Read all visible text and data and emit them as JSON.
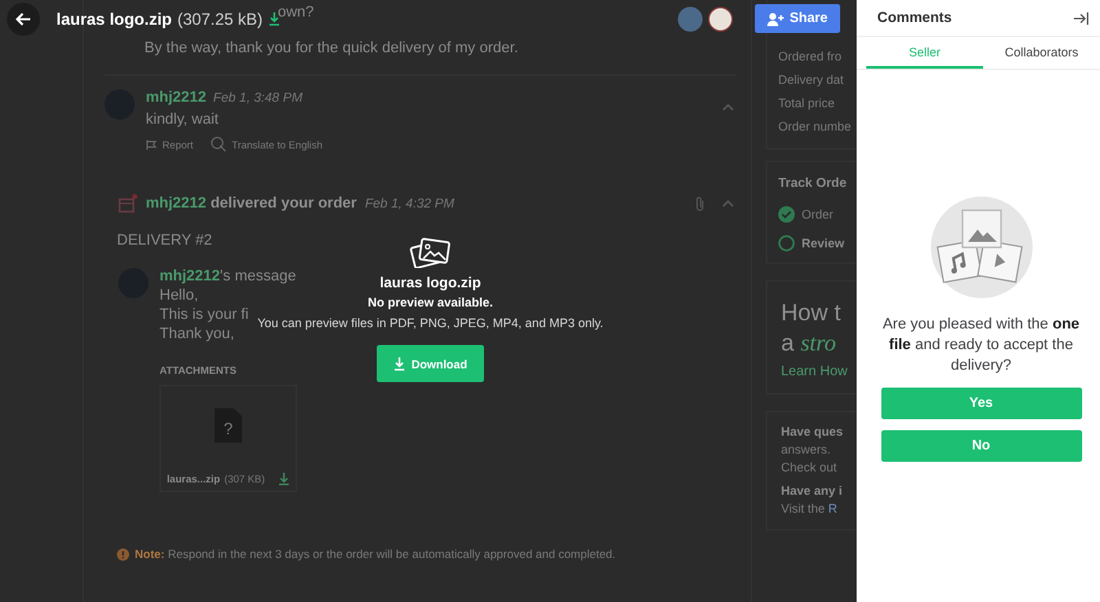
{
  "preview_header": {
    "file_name": "lauras logo.zip",
    "file_size": "(307.25 kB)",
    "share_button": "Share"
  },
  "conversation": {
    "cut_line": "own?",
    "message_tail": "By the way, thank you for the quick delivery of my order.",
    "reply": {
      "author": "mhj2212",
      "time": "Feb 1, 3:48 PM",
      "text": "kindly, wait",
      "actions": [
        "Report",
        "Translate to English"
      ]
    },
    "delivery_event": {
      "author": "mhj2212",
      "action": "delivered your order",
      "time": "Feb 1, 4:32 PM"
    },
    "delivery": {
      "heading": "DELIVERY #2",
      "author": "mhj2212",
      "author_suffix": "'s message",
      "lines": [
        "Hello,",
        "This is your fi",
        "Thank you,"
      ],
      "attachments_heading": "ATTACHMENTS",
      "attachment": {
        "file_icon_mark": "?",
        "name": "lauras...zip",
        "size": "(307 KB)"
      }
    },
    "note": {
      "label": "Note:",
      "text": "Respond in the next 3 days or the order will be automatically approved and completed."
    }
  },
  "order_panel": {
    "details": [
      "Ordered fro",
      "Delivery dat",
      "Total price",
      "Order numbe"
    ],
    "track_title": "Track Orde",
    "track_steps": [
      {
        "label": "Order",
        "done": true
      },
      {
        "label": "Review",
        "done": false
      }
    ],
    "promo": {
      "line_1": "How t",
      "line_2_prefix": "a",
      "line_2_emphasis": "stro",
      "link": "Learn How"
    },
    "help": [
      {
        "kind": "bold",
        "text": "Have ques"
      },
      {
        "kind": "plain",
        "text": "answers."
      },
      {
        "kind": "plain",
        "text": "Check out"
      },
      {
        "kind": "bold",
        "text": "Have any i"
      },
      {
        "kind": "link",
        "text": "Visit the",
        "link": "R"
      }
    ]
  },
  "preview": {
    "file_name": "lauras logo.zip",
    "message": "No preview available.",
    "hint": "You can preview files in PDF, PNG, JPEG, MP4, and MP3 only.",
    "download_button": "Download"
  },
  "comments": {
    "title": "Comments",
    "tabs": [
      {
        "label": "Seller",
        "selected": true
      },
      {
        "label": "Collaborators",
        "selected": false
      }
    ],
    "question": "Are you pleased with the **one file** and ready to accept the delivery?",
    "buttons": [
      "Yes",
      "No"
    ]
  }
}
